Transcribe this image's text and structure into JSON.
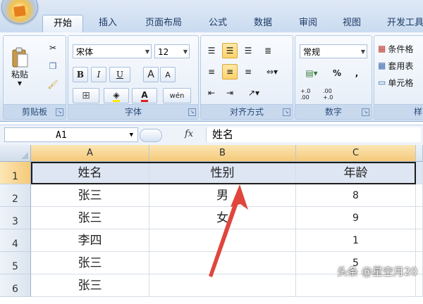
{
  "ribbon": {
    "tabs": [
      "开始",
      "插入",
      "页面布局",
      "公式",
      "数据",
      "审阅",
      "视图",
      "开发工具"
    ],
    "active_tab": "开始",
    "clipboard": {
      "paste_label": "粘贴",
      "group_label": "剪贴板"
    },
    "font": {
      "family": "宋体",
      "size": "12",
      "bold": "B",
      "italic": "I",
      "underline": "U",
      "grow": "A",
      "shrink": "A",
      "phonetic": "wén",
      "font_color_glyph": "A",
      "group_label": "字体"
    },
    "alignment": {
      "group_label": "对齐方式"
    },
    "number": {
      "format": "常规",
      "percent": "%",
      "comma": ",",
      "inc_decimal": "+.0 .00",
      "dec_decimal": ".00 +.0",
      "group_label": "数字"
    },
    "styles": {
      "conditional": "条件格",
      "as_table": "套用表",
      "cell_styles": "单元格",
      "group_label": "样"
    }
  },
  "formula_bar": {
    "name_box": "A1",
    "fx": "fx",
    "content": "姓名"
  },
  "sheet": {
    "columns": [
      "A",
      "B",
      "C"
    ],
    "rows": [
      {
        "num": "1",
        "cells": [
          "姓名",
          "性别",
          "年龄"
        ]
      },
      {
        "num": "2",
        "cells": [
          "张三",
          "男",
          "8"
        ]
      },
      {
        "num": "3",
        "cells": [
          "张三",
          "女",
          "9"
        ]
      },
      {
        "num": "4",
        "cells": [
          "李四",
          "",
          "1"
        ]
      },
      {
        "num": "5",
        "cells": [
          "张三",
          "",
          "5"
        ]
      },
      {
        "num": "6",
        "cells": [
          "张三",
          "",
          ""
        ]
      }
    ]
  },
  "accent": {
    "arrow": "#e0463c",
    "selected_header": "#f5c979"
  },
  "watermark": "头条 @星空月20"
}
